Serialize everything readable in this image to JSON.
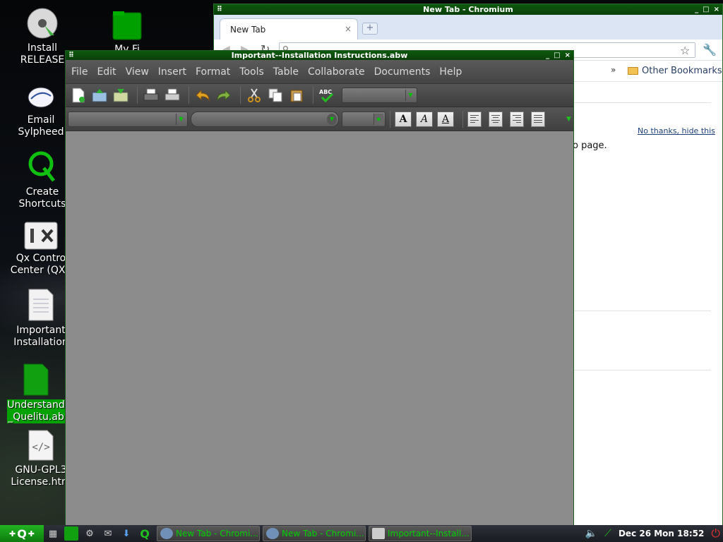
{
  "desktop": {
    "icons": [
      {
        "label1": "Install",
        "label2": "RELEASE"
      },
      {
        "label1": "Email",
        "label2": "Sylpheed"
      },
      {
        "label1": "Create",
        "label2": "Shortcuts"
      },
      {
        "label1": "Qx Contro",
        "label2": "Center (QXC"
      },
      {
        "label1": "Important",
        "label2": "Installation"
      },
      {
        "label1": "Understand",
        "label2": "_Quelitu.ab"
      },
      {
        "label1": "GNU-GPL3",
        "label2": "License.htm"
      },
      {
        "label1": "My Fi",
        "label2": ""
      }
    ]
  },
  "chromium": {
    "title": "New Tab - Chromium",
    "tab_label": "New Tab",
    "tab_close": "×",
    "new_tab_glyph": "+",
    "bookmark_overflow": "»",
    "other_bookmarks": "Other Bookmarks",
    "no_thanks": "No thanks, hide this",
    "body_fragment": "o page."
  },
  "abiword": {
    "title": "Important--Installation Instructions.abw",
    "menu": [
      "File",
      "Edit",
      "View",
      "Insert",
      "Format",
      "Tools",
      "Table",
      "Collaborate",
      "Documents",
      "Help"
    ],
    "format_buttons": {
      "bold": "A",
      "italic": "A",
      "underline": "A"
    }
  },
  "window_controls": {
    "minimize": "_",
    "maximize": "□",
    "close": "×"
  },
  "taskbar": {
    "start_label": "Q",
    "tasks": [
      {
        "label": "New Tab - Chromi..."
      },
      {
        "label": "New Tab - Chromi..."
      },
      {
        "label": "Important--Install..."
      }
    ],
    "clock": "Dec 26 Mon 18:52"
  },
  "colors": {
    "accent": "#00a200",
    "title_bar": "#0d5a0d"
  }
}
